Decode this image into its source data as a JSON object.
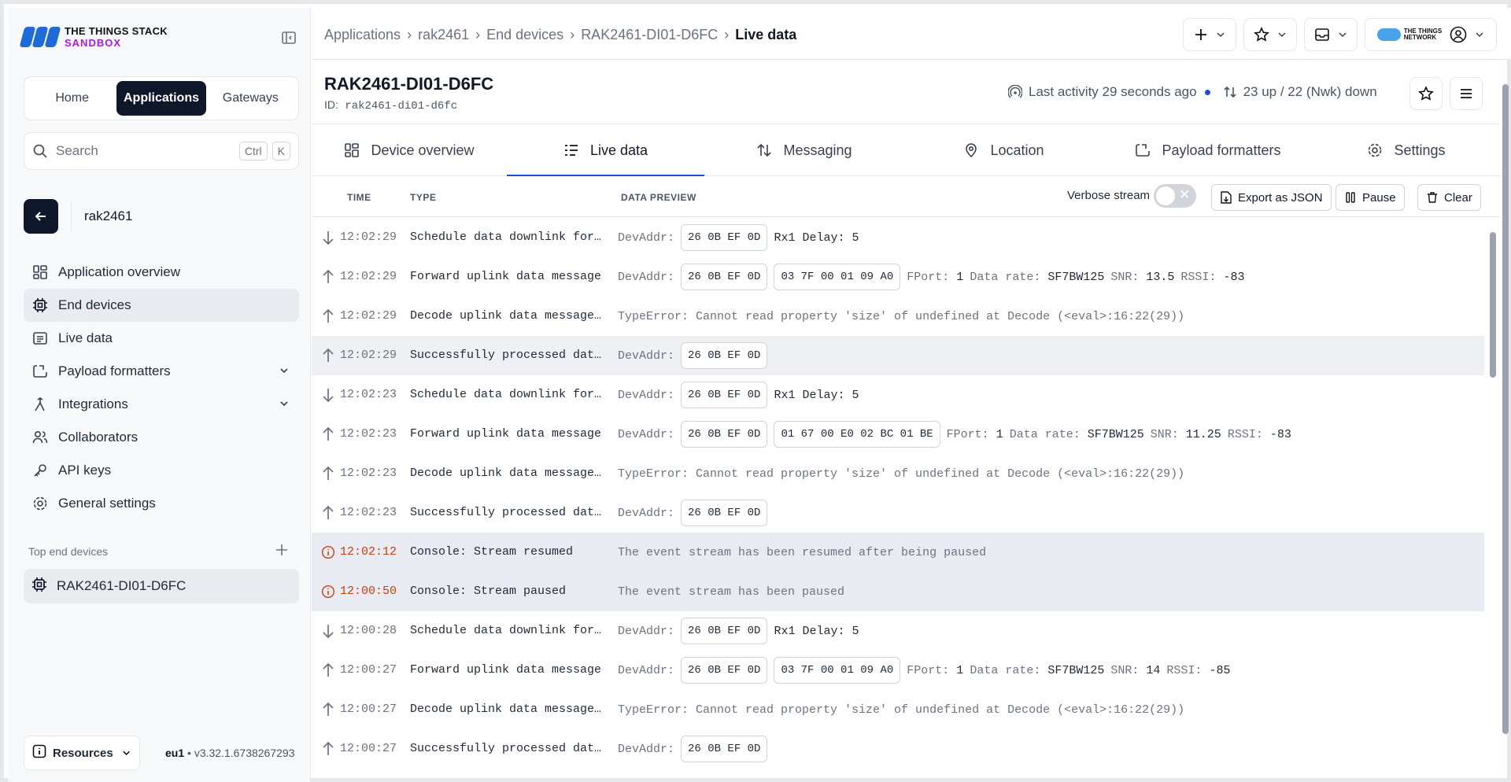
{
  "brand": {
    "line1": "THE THINGS STACK",
    "line2": "SANDBOX"
  },
  "nav_tabs": [
    "Home",
    "Applications",
    "Gateways"
  ],
  "search": {
    "placeholder": "Search",
    "key1": "Ctrl",
    "key2": "K"
  },
  "app_context": {
    "name": "rak2461"
  },
  "sidebar": {
    "items": [
      {
        "label": "Application overview",
        "icon": "grid-icon"
      },
      {
        "label": "End devices",
        "icon": "chip-icon"
      },
      {
        "label": "Live data",
        "icon": "list-icon"
      },
      {
        "label": "Payload formatters",
        "icon": "code-icon"
      },
      {
        "label": "Integrations",
        "icon": "integration-icon"
      },
      {
        "label": "Collaborators",
        "icon": "users-icon"
      },
      {
        "label": "API keys",
        "icon": "key-icon"
      },
      {
        "label": "General settings",
        "icon": "gear-icon"
      }
    ],
    "top_devices_title": "Top end devices",
    "top_device": "RAK2461-DI01-D6FC",
    "resources_label": "Resources",
    "cluster": "eu1",
    "version": "v3.32.1.6738267293"
  },
  "breadcrumb": [
    "Applications",
    "rak2461",
    "End devices",
    "RAK2461-DI01-D6FC",
    "Live data"
  ],
  "device": {
    "title": "RAK2461-DI01-D6FC",
    "id_label": "ID:",
    "id": "rak2461-di01-d6fc",
    "last_activity": "Last activity 29 seconds ago",
    "traffic": "23 up / 22 (Nwk) down"
  },
  "tabs": [
    "Device overview",
    "Live data",
    "Messaging",
    "Location",
    "Payload formatters",
    "Settings"
  ],
  "table": {
    "headers": {
      "time": "TIME",
      "type": "TYPE",
      "preview": "DATA PREVIEW"
    },
    "verbose_label": "Verbose stream",
    "export_label": "Export as JSON",
    "pause_label": "Pause",
    "clear_label": "Clear"
  },
  "events": [
    {
      "dir": "down",
      "time": "12:02:29",
      "type": "Schedule data downlink for…",
      "devaddr": "26 0B EF 0D",
      "extra": "Rx1 Delay: 5"
    },
    {
      "dir": "up",
      "time": "12:02:29",
      "type": "Forward uplink data message",
      "devaddr": "26 0B EF 0D",
      "payload": "03 7F 00 01 09 A0",
      "fport": "1",
      "datarate": "SF7BW125",
      "snr": "13.5",
      "rssi": "-83"
    },
    {
      "dir": "up",
      "time": "12:02:29",
      "type": "Decode uplink data message…",
      "text": "TypeError: Cannot read property 'size' of undefined at Decode (<eval>:16:22(29))"
    },
    {
      "dir": "up",
      "time": "12:02:29",
      "type": "Successfully processed dat…",
      "devaddr": "26 0B EF 0D",
      "highlight": true
    },
    {
      "dir": "down",
      "time": "12:02:23",
      "type": "Schedule data downlink for…",
      "devaddr": "26 0B EF 0D",
      "extra": "Rx1 Delay: 5"
    },
    {
      "dir": "up",
      "time": "12:02:23",
      "type": "Forward uplink data message",
      "devaddr": "26 0B EF 0D",
      "payload": "01 67 00 E0 02 BC 01 BE",
      "fport": "1",
      "datarate": "SF7BW125",
      "snr": "11.25",
      "rssi": "-83"
    },
    {
      "dir": "up",
      "time": "12:02:23",
      "type": "Decode uplink data message…",
      "text": "TypeError: Cannot read property 'size' of undefined at Decode (<eval>:16:22(29))"
    },
    {
      "dir": "up",
      "time": "12:02:23",
      "type": "Successfully processed dat…",
      "devaddr": "26 0B EF 0D"
    },
    {
      "dir": "info",
      "time": "12:02:12",
      "type": "Console: Stream resumed",
      "text": "The event stream has been resumed after being paused"
    },
    {
      "dir": "info",
      "time": "12:00:50",
      "type": "Console: Stream paused",
      "text": "The event stream has been paused"
    },
    {
      "dir": "down",
      "time": "12:00:28",
      "type": "Schedule data downlink for…",
      "devaddr": "26 0B EF 0D",
      "extra": "Rx1 Delay: 5"
    },
    {
      "dir": "up",
      "time": "12:00:27",
      "type": "Forward uplink data message",
      "devaddr": "26 0B EF 0D",
      "payload": "03 7F 00 01 09 A0",
      "fport": "1",
      "datarate": "SF7BW125",
      "snr": "14",
      "rssi": "-85"
    },
    {
      "dir": "up",
      "time": "12:00:27",
      "type": "Decode uplink data message…",
      "text": "TypeError: Cannot read property 'size' of undefined at Decode (<eval>:16:22(29))"
    },
    {
      "dir": "up",
      "time": "12:00:27",
      "type": "Successfully processed dat…",
      "devaddr": "26 0B EF 0D"
    }
  ],
  "labels": {
    "devaddr": "DevAddr:",
    "fport": "FPort:",
    "datarate": "Data rate:",
    "snr": "SNR:",
    "rssi": "RSSI:"
  },
  "colors": {
    "accent": "#1d4ed8",
    "dark": "#0f172a",
    "warn": "#c2410c",
    "brand_purple": "#a81ae0",
    "brand_blue": "#1e6ad6"
  }
}
